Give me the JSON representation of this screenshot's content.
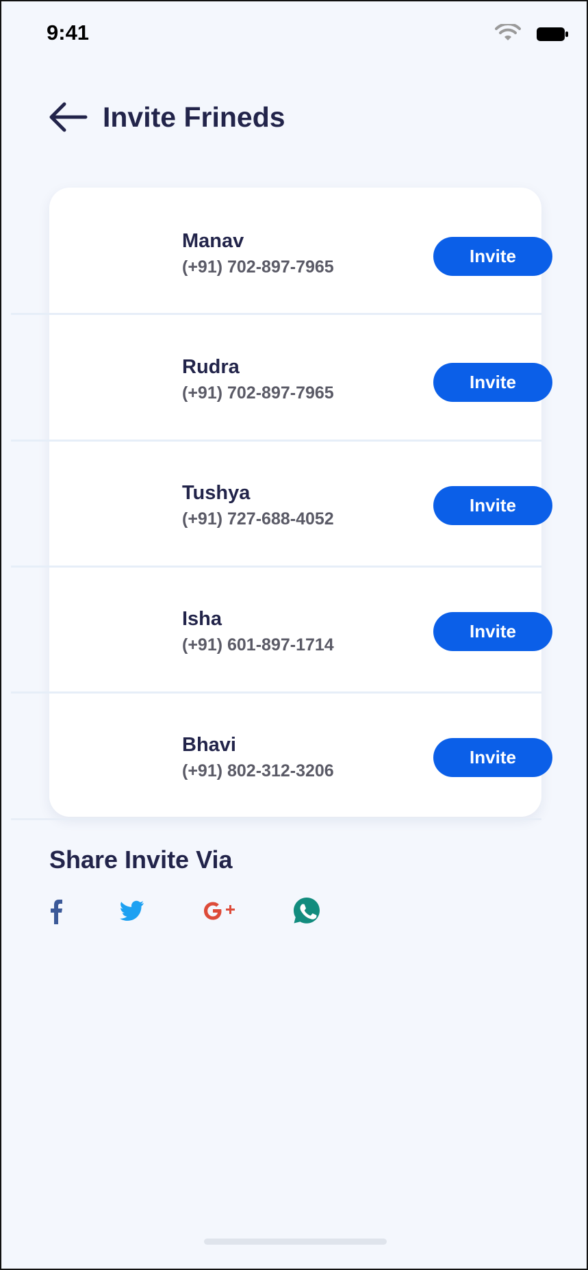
{
  "status_bar": {
    "time": "9:41"
  },
  "header": {
    "title": "Invite Frineds"
  },
  "contacts": [
    {
      "name": "Manav",
      "phone": "(+91) 702-897-7965",
      "action": "Invite"
    },
    {
      "name": "Rudra",
      "phone": "(+91) 702-897-7965",
      "action": "Invite"
    },
    {
      "name": "Tushya",
      "phone": "(+91) 727-688-4052",
      "action": "Invite"
    },
    {
      "name": "Isha",
      "phone": "(+91) 601-897-1714",
      "action": "Invite"
    },
    {
      "name": "Bhavi",
      "phone": "(+91) 802-312-3206",
      "action": "Invite"
    }
  ],
  "share": {
    "title": "Share Invite Via",
    "icons": [
      "facebook-icon",
      "twitter-icon",
      "google-plus-icon",
      "whatsapp-icon"
    ]
  },
  "colors": {
    "background": "#f4f7fd",
    "card": "#ffffff",
    "accent": "#0b5fe8",
    "title": "#22244a",
    "phone_text": "#5a5a66",
    "facebook": "#3b5998",
    "twitter": "#1da1f2",
    "google_plus": "#dd4b39",
    "whatsapp": "#128c7e"
  }
}
